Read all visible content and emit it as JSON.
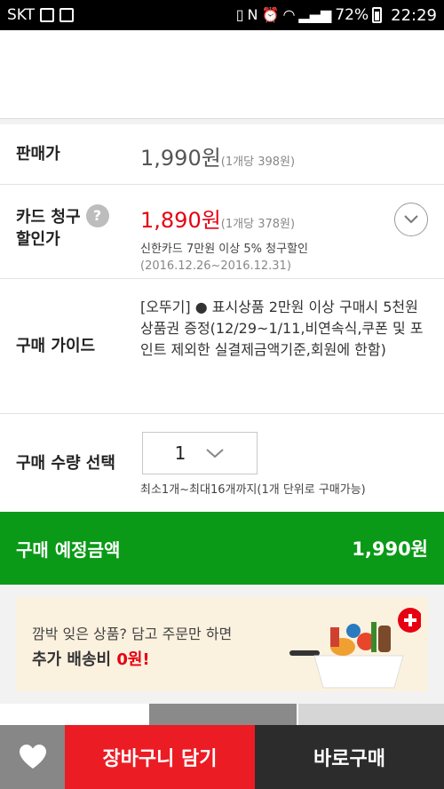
{
  "status_bar": {
    "carrier": "SKT",
    "battery": "72%",
    "time": "22:29"
  },
  "price": {
    "label": "판매가",
    "amount": "1,990원",
    "unit_price": "(1개당 398원)"
  },
  "card_discount": {
    "label_line1": "카드 청구",
    "label_line2": "할인가",
    "help_icon": "?",
    "amount": "1,890원",
    "unit_price": "(1개당 378원)",
    "description": "신한카드 7만원 이상 5% 청구할인",
    "period": "(2016.12.26~2016.12.31)"
  },
  "guide": {
    "label": "구매 가이드",
    "text": "[오뚜기] ● 표시상품 2만원 이상 구매시 5천원 상품권 증정(12/29~1/11,비연속식,쿠폰 및 포인트 제외한 실결제금액기준,회원에 한함)"
  },
  "quantity": {
    "label": "구매 수량 선택",
    "value": "1",
    "note": "최소1개~최대16개까지(1개 단위로 구매가능)"
  },
  "total": {
    "label": "구매 예정금액",
    "amount": "1,990원"
  },
  "banner": {
    "line1": "깜박 잊은 상품? 담고 주문만 하면",
    "line2_prefix": "추가 배송비 ",
    "line2_highlight": "0원!"
  },
  "bottom_bar": {
    "cart_label": "장바구니 담기",
    "buy_label": "바로구매"
  },
  "colors": {
    "accent_red": "#e60012",
    "green_bar": "#0a9a17",
    "cart_button": "#ec1c24",
    "buy_button": "#2c2c2c"
  }
}
